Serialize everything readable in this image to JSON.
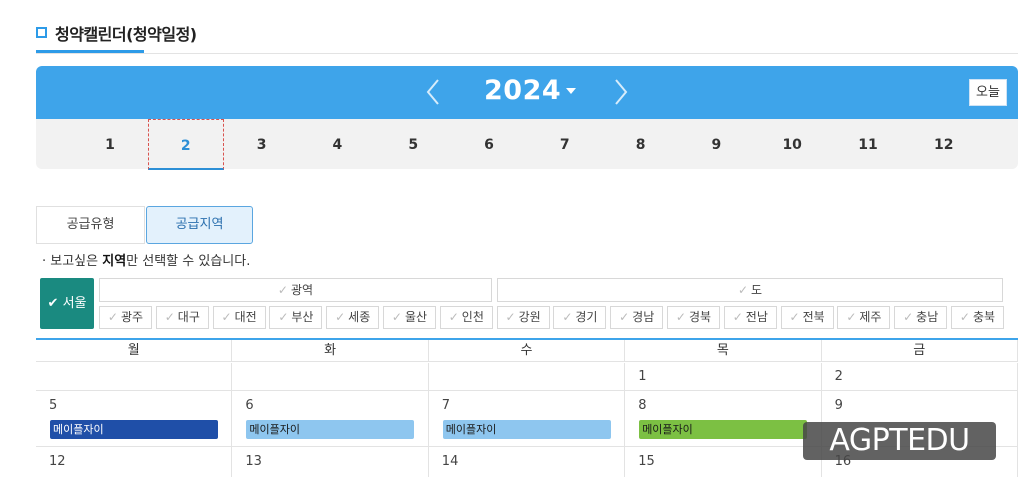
{
  "page": {
    "title": "청약캘린더(청약일정)"
  },
  "calendar_nav": {
    "year": "2024",
    "today_label": "오늘",
    "months": [
      "1",
      "2",
      "3",
      "4",
      "5",
      "6",
      "7",
      "8",
      "9",
      "10",
      "11",
      "12"
    ],
    "active_month": "2"
  },
  "filter": {
    "tabs": {
      "type": "공급유형",
      "region": "공급지역"
    },
    "active_tab": "region",
    "hint_prefix": "· 보고싶은 ",
    "hint_bold": "지역",
    "hint_suffix": "만 선택할 수 있습니다.",
    "seoul_label": "서울",
    "metro_group": "광역",
    "province_group": "도",
    "metro_regions": [
      "광주",
      "대구",
      "대전",
      "부산",
      "세종",
      "울산",
      "인천"
    ],
    "province_regions": [
      "강원",
      "경기",
      "경남",
      "경북",
      "전남",
      "전북",
      "제주",
      "충남",
      "충북"
    ]
  },
  "weekdays": [
    "월",
    "화",
    "수",
    "목",
    "금"
  ],
  "weeks": [
    [
      {
        "day": ""
      },
      {
        "day": ""
      },
      {
        "day": ""
      },
      {
        "day": "1"
      },
      {
        "day": "2"
      }
    ],
    [
      {
        "day": "5",
        "event": "메이플자이",
        "event_color": "#1f4fa8"
      },
      {
        "day": "6",
        "event": "메이플자이",
        "event_color": "#8ec6ef"
      },
      {
        "day": "7",
        "event": "메이플자이",
        "event_color": "#8ec6ef"
      },
      {
        "day": "8",
        "event": "메이플자이",
        "event_color": "#7cc043"
      },
      {
        "day": "9"
      }
    ],
    [
      {
        "day": "12"
      },
      {
        "day": "13"
      },
      {
        "day": "14"
      },
      {
        "day": "15"
      },
      {
        "day": "16"
      }
    ]
  ],
  "watermark": "AGPTEDU",
  "colors": {
    "accent": "#3ea4ea",
    "seoul": "#1a8a80"
  }
}
